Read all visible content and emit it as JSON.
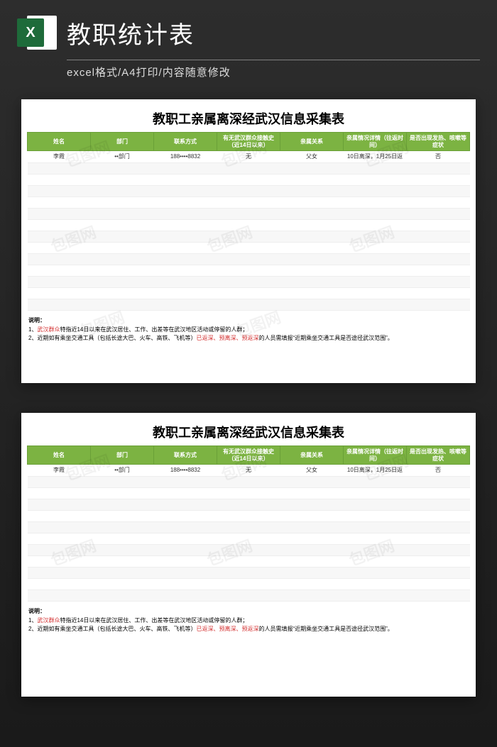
{
  "header": {
    "excel_letter": "X",
    "main_title": "教职统计表",
    "sub_title": "excel格式/A4打印/内容随意修改"
  },
  "sheet": {
    "title": "教职工亲属离深经武汉信息采集表",
    "columns": [
      "姓名",
      "部门",
      "联系方式",
      "有无武汉群众接触史（近14日以来）",
      "亲属关系",
      "亲属情况详情（往返时间）",
      "是否出现发热、咳嗽等症状"
    ],
    "row": {
      "name": "李霞",
      "dept": "••部门",
      "phone": "188••••8832",
      "contact_history": "无",
      "relation": "父女",
      "detail": "10日离深，1月25日返",
      "symptom": "否"
    },
    "notes_label": "说明：",
    "note1_prefix": "1、",
    "note1_red": "武汉群众",
    "note1_rest": "特指近14日以来在武汉居住、工作、出差等在武汉地区活动或停留的人群；",
    "note2_prefix": "2、近期如有乘坐交通工具（包括长途大巴、火车、高铁、飞机等）",
    "note2_red": "已返深、预离深、预返深",
    "note2_rest": "的人员需填报“近期乘坐交通工具是否途径武汉范围”。"
  },
  "watermark_text": "包图网"
}
